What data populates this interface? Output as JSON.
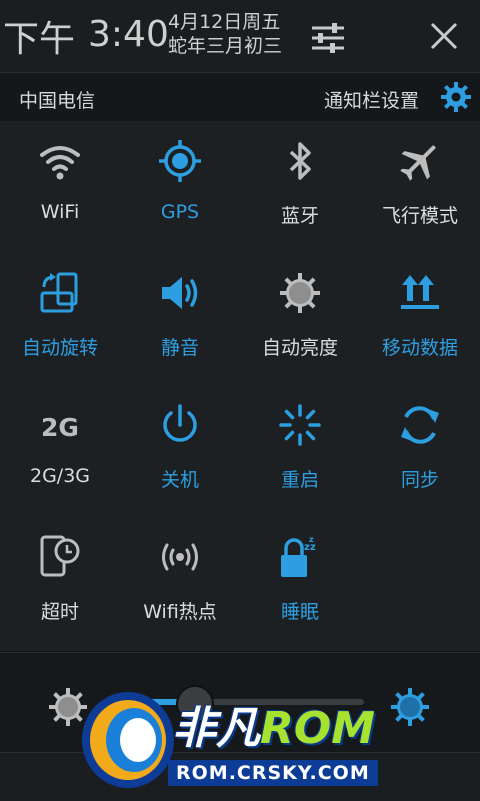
{
  "header": {
    "ampm": "下午",
    "time": "3:40",
    "date_line1": "4月12日周五",
    "date_line2": "蛇年三月初三"
  },
  "carrier_bar": {
    "carrier": "中国电信",
    "notif_settings": "通知栏设置"
  },
  "colors": {
    "accent": "#2d9ee0",
    "inactive": "#bdbdbd",
    "panel": "#1d2023"
  },
  "toggles": [
    {
      "label": "WiFi",
      "icon": "wifi-icon",
      "active": false
    },
    {
      "label": "GPS",
      "icon": "gps-icon",
      "active": true
    },
    {
      "label": "蓝牙",
      "icon": "bluetooth-icon",
      "active": false
    },
    {
      "label": "飞行模式",
      "icon": "airplane-icon",
      "active": false
    },
    {
      "label": "自动旋转",
      "icon": "rotate-icon",
      "active": true
    },
    {
      "label": "静音",
      "icon": "speaker-icon",
      "active": true
    },
    {
      "label": "自动亮度",
      "icon": "brightness-icon",
      "active": false
    },
    {
      "label": "移动数据",
      "icon": "mobile-data-icon",
      "active": true
    },
    {
      "label": "2G/3G",
      "icon": "2g-icon",
      "active": false
    },
    {
      "label": "关机",
      "icon": "power-icon",
      "active": true
    },
    {
      "label": "重启",
      "icon": "reboot-icon",
      "active": true
    },
    {
      "label": "同步",
      "icon": "sync-icon",
      "active": true
    },
    {
      "label": "超时",
      "icon": "timeout-icon",
      "active": false
    },
    {
      "label": "Wifi热点",
      "icon": "hotspot-icon",
      "active": false
    },
    {
      "label": "睡眠",
      "icon": "sleep-icon",
      "active": true
    }
  ],
  "brightness": {
    "level": 0.32
  },
  "watermark": {
    "brand_cn": "非凡",
    "brand_rom": "ROM",
    "url": "ROM.CRSKY.COM"
  }
}
